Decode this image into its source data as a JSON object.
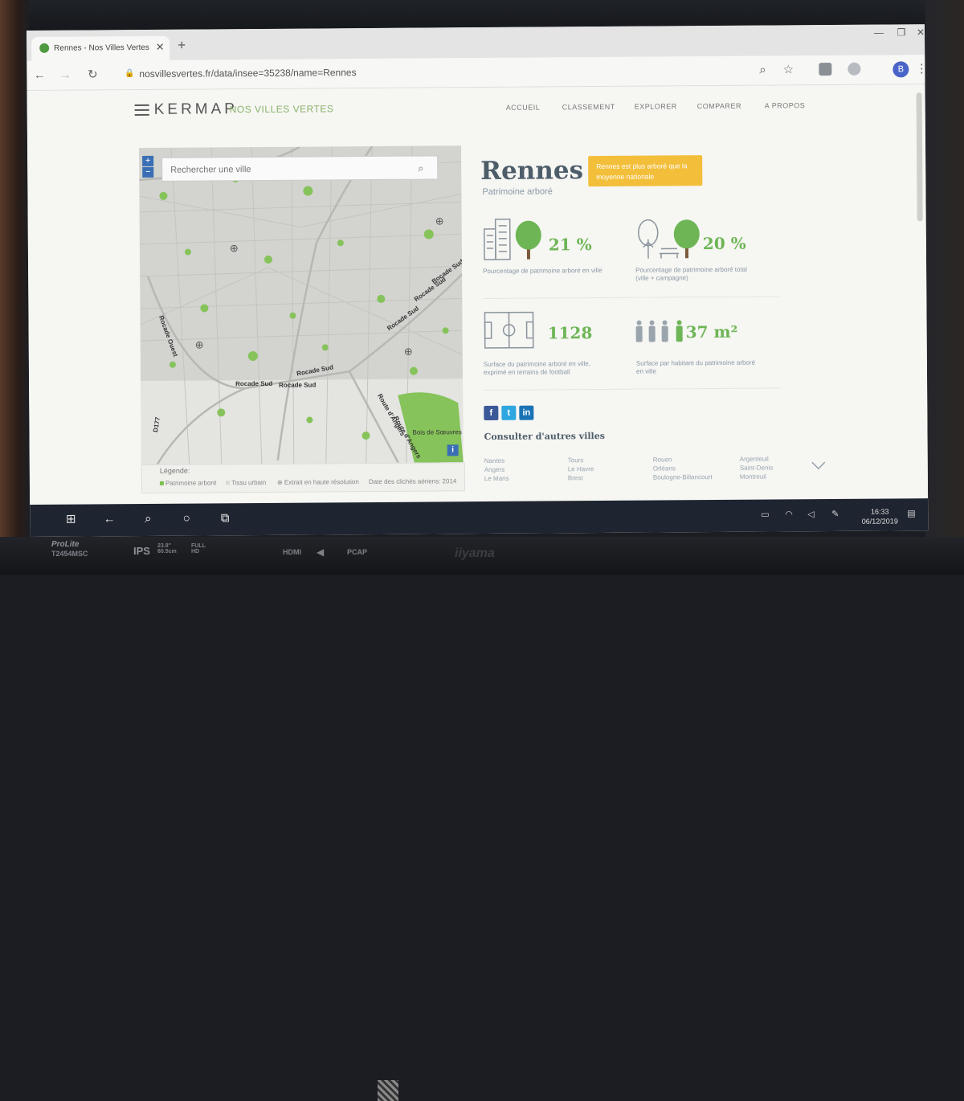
{
  "browser": {
    "tab_title": "Rennes - Nos Villes Vertes by K",
    "url": "nosvillesvertes.fr/data/insee=35238/name=Rennes",
    "avatar_letter": "B"
  },
  "header": {
    "brand": "KERMAP",
    "brand_sub": "NOS VILLES VERTES",
    "nav": [
      "ACCUEIL",
      "CLASSEMENT",
      "EXPLORER",
      "COMPARER",
      "A PROPOS"
    ]
  },
  "map": {
    "zoom_in": "+",
    "zoom_out": "−",
    "search_placeholder": "Rechercher une ville",
    "road_labels": [
      "Rocade Ouest",
      "Rocade Sud",
      "Rocade Sud",
      "Rocade Sud",
      "Rocade Sud",
      "Rocade Sud",
      "Rocade Sud",
      "Route d'Angers",
      "Route d'Angers",
      "D177",
      "Bois de Sœuvres"
    ],
    "info_label": "i"
  },
  "legend": {
    "title": "Légende:",
    "items": [
      "Patrimoine arboré",
      "Tissu urbain",
      "Extrait en haute résolution",
      "Date des clichés aériens: 2014"
    ],
    "colors": {
      "patrimoine": "#7cc04f",
      "tissu": "#d8d8d6"
    }
  },
  "city": {
    "name": "Rennes",
    "subtitle": "Patrimoine arboré",
    "badge": "Rennes est plus arboré que la moyenne nationale"
  },
  "stats": [
    {
      "value": "21 %",
      "label": "Pourcentage de patrimoine arboré en ville"
    },
    {
      "value": "20 %",
      "label": "Pourcentage de patrimoine arboré total (ville + campagne)"
    },
    {
      "value": "1128",
      "label": "Surface du patrimoine arboré en ville, exprimé en terrains de football"
    },
    {
      "value": "37 m²",
      "label": "Surface par habitant du patrimoine arboré en ville"
    }
  ],
  "social": [
    "f",
    "t",
    "in"
  ],
  "others": {
    "title": "Consulter d'autres villes",
    "columns": [
      [
        "Nantes",
        "Angers",
        "Le Mans"
      ],
      [
        "Tours",
        "Le Havre",
        "Brest"
      ],
      [
        "Rouen",
        "Orléans",
        "Boulogne-Billancourt"
      ],
      [
        "Argenteuil",
        "Saint-Denis",
        "Montreuil"
      ]
    ]
  },
  "taskbar": {
    "time": "16:33",
    "date": "06/12/2019"
  },
  "monitor": {
    "model": "ProLite",
    "model_code": "T2454MSC",
    "ips": "IPS",
    "size": "23.8\" 60.5cm",
    "hd": "FULL HD",
    "hdmi": "HDMI",
    "pcap": "PCAP",
    "brand": "iiyama"
  },
  "colors": {
    "accent_green": "#6db555",
    "badge": "#f3bf3a",
    "slate": "#4d5d69"
  }
}
